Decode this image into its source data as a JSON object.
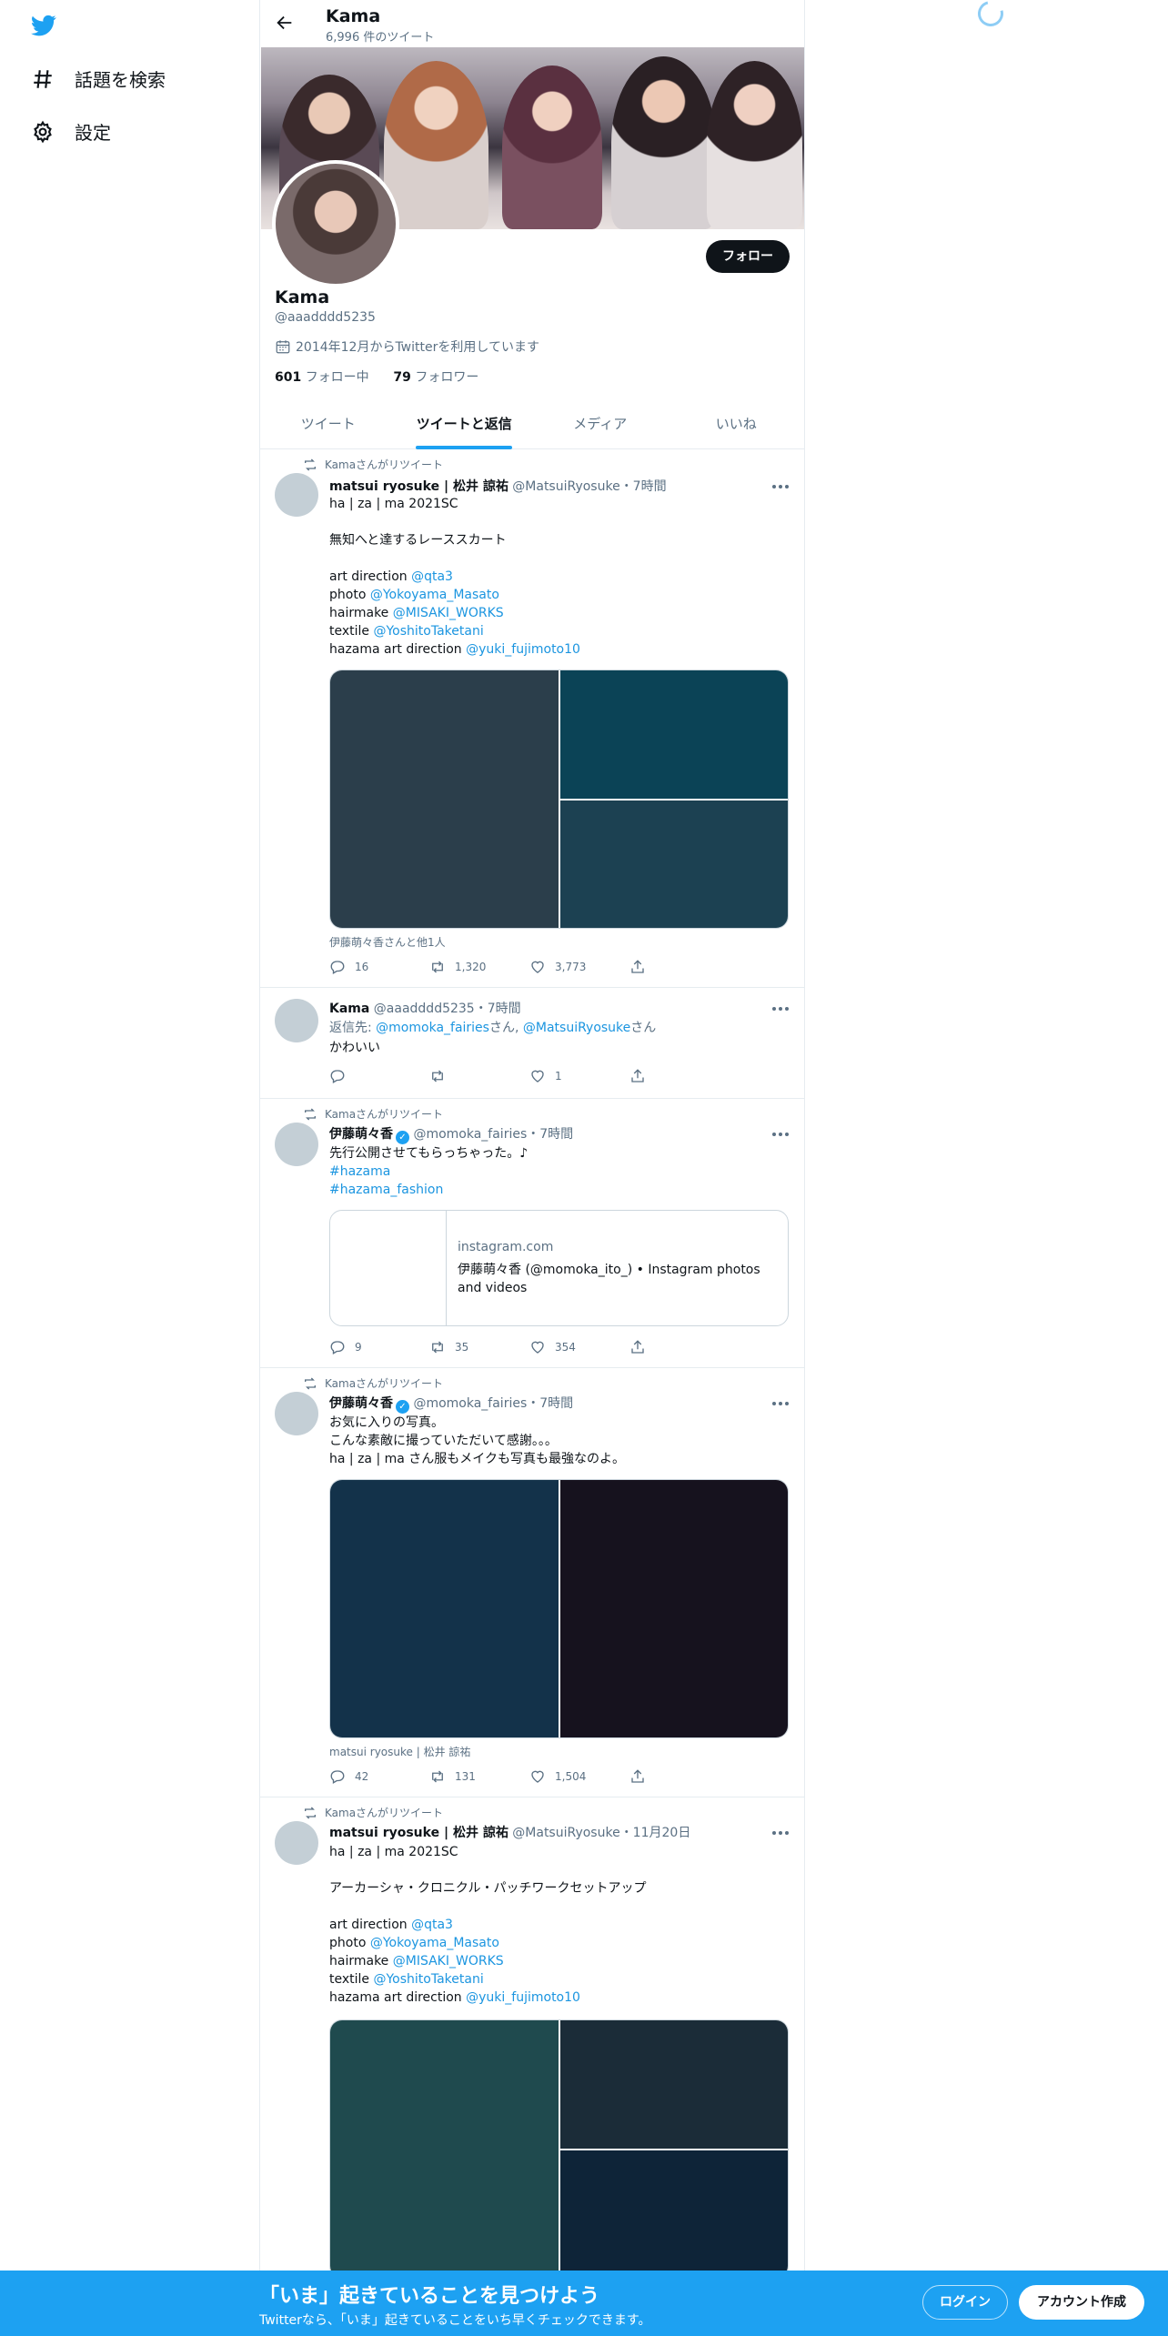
{
  "sidebar": {
    "items": [
      {
        "label": "話題を検索",
        "icon": "hashtag-icon"
      },
      {
        "label": "設定",
        "icon": "gear-icon"
      }
    ]
  },
  "header": {
    "title": "Kama",
    "subtitle": "6,996 件のツイート"
  },
  "profile": {
    "name": "Kama",
    "handle": "@aaadddd5235",
    "joined": "2014年12月からTwitterを利用しています",
    "following_count": "601",
    "following_label": "フォロー中",
    "followers_count": "79",
    "followers_label": "フォロワー",
    "follow_button": "フォロー"
  },
  "tabs": [
    {
      "label": "ツイート",
      "active": false
    },
    {
      "label": "ツイートと返信",
      "active": true
    },
    {
      "label": "メディア",
      "active": false
    },
    {
      "label": "いいね",
      "active": false
    }
  ],
  "tweets": [
    {
      "retweet_by": "Kamaさんがリツイート",
      "name": "matsui ryosuke | 松井 諒祐",
      "handle": "@MatsuiRyosuke",
      "time": "・7時間",
      "lines": [
        {
          "text": "ha | za | ma 2021SC"
        },
        {
          "text": ""
        },
        {
          "text": "無知へと達するレーススカート"
        },
        {
          "text": ""
        },
        {
          "prefix": "art direction ",
          "link": "@qta3"
        },
        {
          "prefix": "photo ",
          "link": "@Yokoyama_Masato"
        },
        {
          "prefix": "hairmake ",
          "link": "@MISAKI_WORKS"
        },
        {
          "prefix": "textile ",
          "link": "@YoshitoTaketani"
        },
        {
          "prefix": "hazama art direction ",
          "link": "@yuki_fujimoto10"
        }
      ],
      "caption": "伊藤萌々香さんと他1人",
      "replies": "16",
      "retweets": "1,320",
      "likes": "3,773"
    },
    {
      "name": "Kama",
      "handle": "@aaadddd5235",
      "time": "・7時間",
      "reply_label": "返信先: ",
      "reply_to_1": "@momoka_fairies",
      "reply_sep": "さん, ",
      "reply_to_2": "@MatsuiRyosuke",
      "reply_end": "さん",
      "text": "かわいい",
      "replies": "",
      "retweets": "",
      "likes": "1"
    },
    {
      "retweet_by": "Kamaさんがリツイート",
      "name": "伊藤萌々香",
      "handle": "@momoka_fairies",
      "time": "・7時間",
      "text": "先行公開させてもらっちゃった。♪",
      "hashtags": [
        "#hazama",
        "#hazama_fashion"
      ],
      "card_domain": "instagram.com",
      "card_title": "伊藤萌々香 (@momoka_ito_) • Instagram photos and videos",
      "replies": "9",
      "retweets": "35",
      "likes": "354"
    },
    {
      "retweet_by": "Kamaさんがリツイート",
      "name": "伊藤萌々香",
      "handle": "@momoka_fairies",
      "time": "・7時間",
      "text": "お気に入りの写真。\nこんな素敵に撮っていただいて感謝。。。\nha | za | ma さん服もメイクも写真も最強なのよ。",
      "caption": "matsui ryosuke | 松井 諒祐",
      "replies": "42",
      "retweets": "131",
      "likes": "1,504"
    },
    {
      "retweet_by": "Kamaさんがリツイート",
      "name": "matsui ryosuke | 松井 諒祐",
      "handle": "@MatsuiRyosuke",
      "time": "・11月20日",
      "lines": [
        {
          "text": "ha | za | ma 2021SC"
        },
        {
          "text": ""
        },
        {
          "text": "アーカーシャ・クロニクル・パッチワークセットアップ"
        },
        {
          "text": ""
        },
        {
          "prefix": "art direction ",
          "link": "@qta3"
        },
        {
          "prefix": "photo ",
          "link": "@Yokoyama_Masato"
        },
        {
          "prefix": "hairmake ",
          "link": "@MISAKI_WORKS"
        },
        {
          "prefix": "textile ",
          "link": "@YoshitoTaketani"
        },
        {
          "prefix": "hazama art direction ",
          "link": "@yuki_fujimoto10"
        }
      ]
    }
  ],
  "bottom_bar": {
    "title": "「いま」起きていることを見つけよう",
    "subtitle": "Twitterなら、「いま」起きていることをいち早くチェックできます。",
    "login": "ログイン",
    "signup": "アカウント作成"
  },
  "colors": {
    "accent": "#1da1f2",
    "link": "#1b95e0",
    "text": "#0f1419",
    "muted": "#5b7083"
  }
}
